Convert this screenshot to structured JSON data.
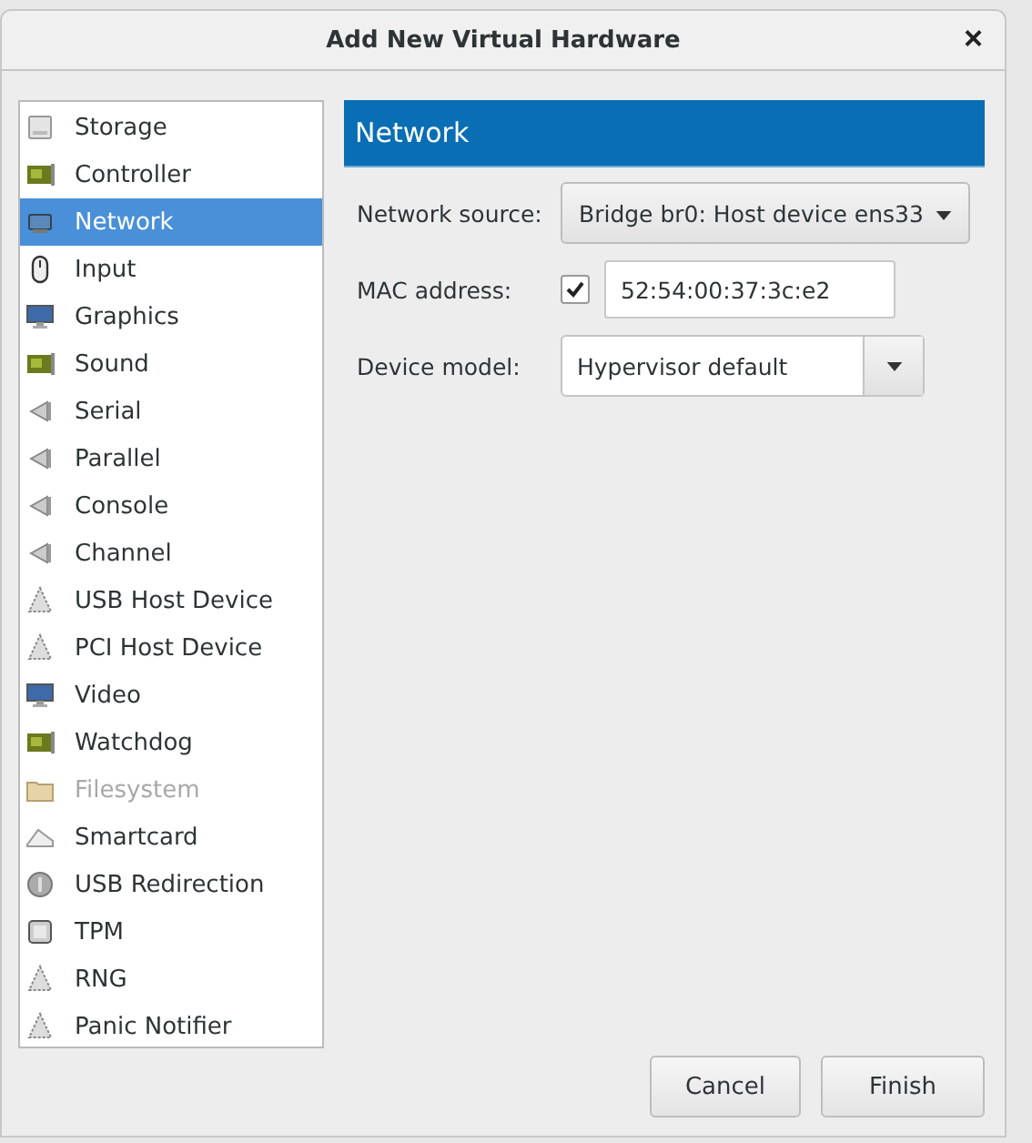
{
  "window": {
    "title": "Add New Virtual Hardware",
    "close": "×"
  },
  "sidebar": {
    "items": [
      {
        "label": "Storage",
        "kind": "disk",
        "selected": false,
        "disabled": false
      },
      {
        "label": "Controller",
        "kind": "card",
        "selected": false,
        "disabled": false
      },
      {
        "label": "Network",
        "kind": "network",
        "selected": true,
        "disabled": false
      },
      {
        "label": "Input",
        "kind": "mouse",
        "selected": false,
        "disabled": false
      },
      {
        "label": "Graphics",
        "kind": "monitor",
        "selected": false,
        "disabled": false
      },
      {
        "label": "Sound",
        "kind": "card",
        "selected": false,
        "disabled": false
      },
      {
        "label": "Serial",
        "kind": "port",
        "selected": false,
        "disabled": false
      },
      {
        "label": "Parallel",
        "kind": "port",
        "selected": false,
        "disabled": false
      },
      {
        "label": "Console",
        "kind": "port",
        "selected": false,
        "disabled": false
      },
      {
        "label": "Channel",
        "kind": "port",
        "selected": false,
        "disabled": false
      },
      {
        "label": "USB Host Device",
        "kind": "chip",
        "selected": false,
        "disabled": false
      },
      {
        "label": "PCI Host Device",
        "kind": "chip",
        "selected": false,
        "disabled": false
      },
      {
        "label": "Video",
        "kind": "monitor",
        "selected": false,
        "disabled": false
      },
      {
        "label": "Watchdog",
        "kind": "card",
        "selected": false,
        "disabled": false
      },
      {
        "label": "Filesystem",
        "kind": "folder",
        "selected": false,
        "disabled": true
      },
      {
        "label": "Smartcard",
        "kind": "smartcard",
        "selected": false,
        "disabled": false
      },
      {
        "label": "USB Redirection",
        "kind": "usb",
        "selected": false,
        "disabled": false
      },
      {
        "label": "TPM",
        "kind": "tpm",
        "selected": false,
        "disabled": false
      },
      {
        "label": "RNG",
        "kind": "chip",
        "selected": false,
        "disabled": false
      },
      {
        "label": "Panic Notifier",
        "kind": "chip",
        "selected": false,
        "disabled": false
      }
    ]
  },
  "panel": {
    "header": "Network",
    "network_source": {
      "label": "Network source:",
      "value": "Bridge br0: Host device ens33"
    },
    "mac_address": {
      "label": "MAC address:",
      "checked": true,
      "value": "52:54:00:37:3c:e2"
    },
    "device_model": {
      "label": "Device model:",
      "value": "Hypervisor default"
    }
  },
  "buttons": [
    "Cancel",
    "Finish"
  ]
}
